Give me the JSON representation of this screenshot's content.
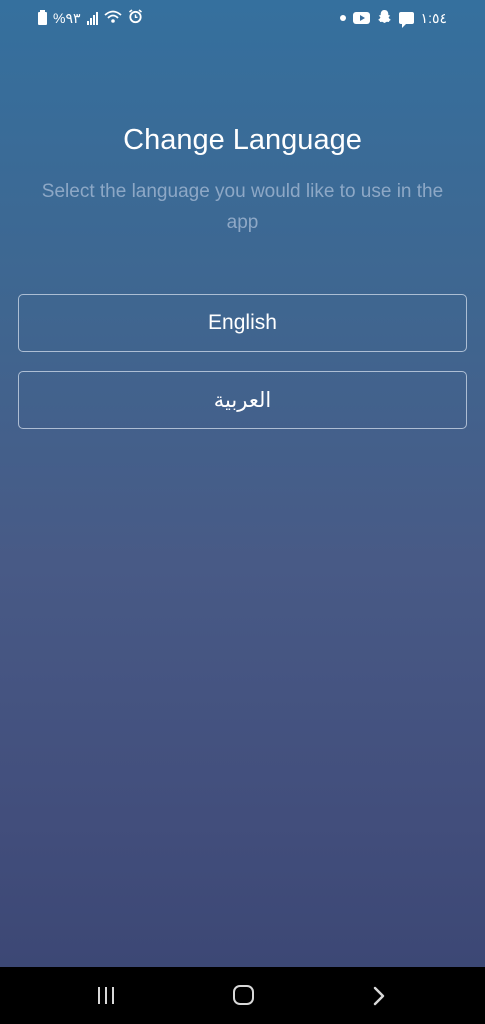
{
  "status_bar": {
    "battery_text": "%٩٣",
    "time": "١:٥٤",
    "icons_left": [
      "battery-icon",
      "signal-icon",
      "wifi-icon",
      "alarm-icon"
    ],
    "icons_right": [
      "notification-dot-icon",
      "youtube-icon",
      "snapchat-icon",
      "message-icon"
    ]
  },
  "screen": {
    "title": "Change Language",
    "subtitle": "Select the language you would like to use in the app"
  },
  "languages": [
    {
      "label": "English"
    },
    {
      "label": "العربية"
    }
  ],
  "nav_bar": {
    "icons": [
      "recents-icon",
      "home-icon",
      "back-icon"
    ]
  },
  "colors": {
    "gradient_top": "#35709e",
    "gradient_bottom": "#3a4572",
    "text_primary": "#ffffff",
    "text_secondary": "#aabed7",
    "nav_background": "#000000"
  }
}
